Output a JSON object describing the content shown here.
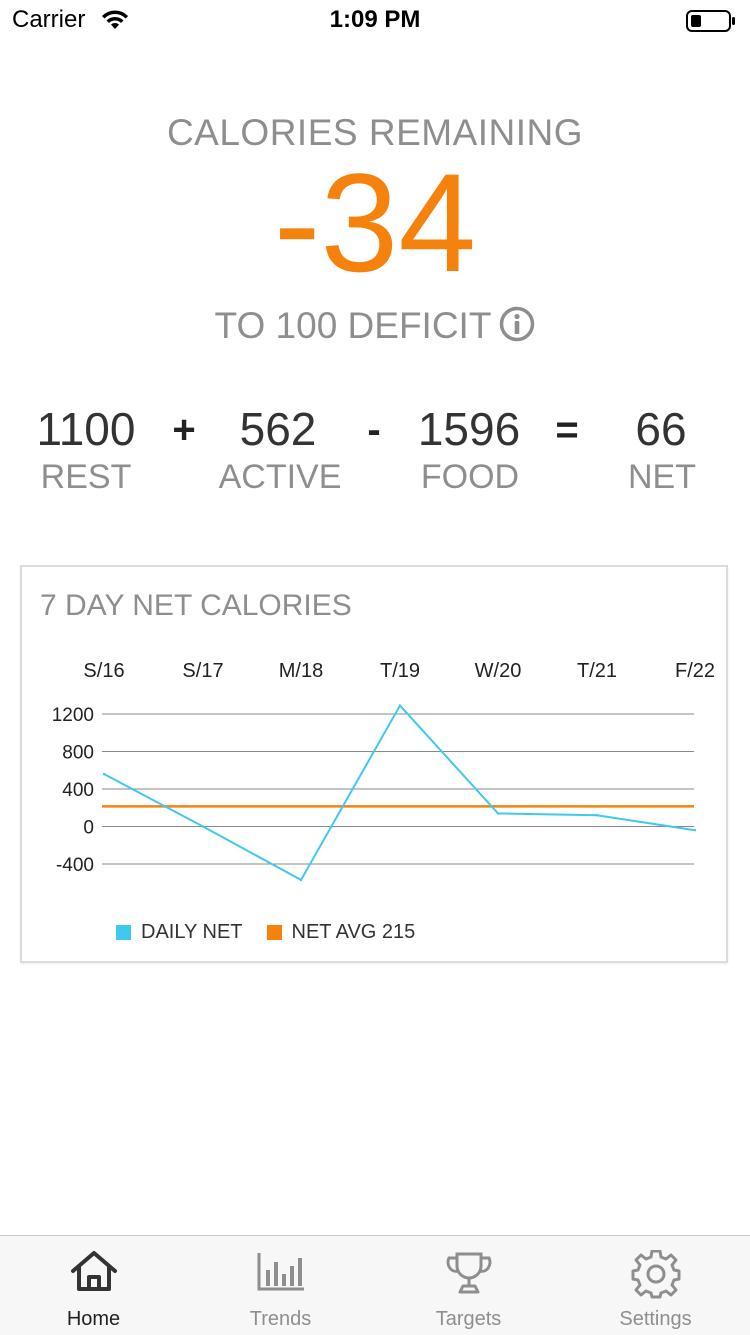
{
  "status_bar": {
    "carrier": "Carrier",
    "time": "1:09 PM"
  },
  "summary": {
    "title": "CALORIES REMAINING",
    "value": "-34",
    "subtitle": "TO 100 DEFICIT",
    "accent_color": "#f5820d"
  },
  "equation": {
    "rest": {
      "value": "1100",
      "label": "REST"
    },
    "active": {
      "value": "562",
      "label": "ACTIVE"
    },
    "food": {
      "value": "1596",
      "label": "FOOD"
    },
    "net": {
      "value": "66",
      "label": "NET"
    },
    "op_plus": "+",
    "op_minus": "-",
    "op_equals": "="
  },
  "chart_card": {
    "title": "7 DAY NET CALORIES"
  },
  "chart_data": {
    "type": "line",
    "categories": [
      "S/16",
      "S/17",
      "M/18",
      "T/19",
      "W/20",
      "T/21",
      "F/22"
    ],
    "series": [
      {
        "name": "DAILY NET",
        "values": [
          560,
          0,
          -570,
          1290,
          140,
          120,
          -40
        ],
        "color": "#3fc8f0"
      },
      {
        "name": "NET AVG 215",
        "values": [
          215,
          215,
          215,
          215,
          215,
          215,
          215
        ],
        "color": "#f5820d"
      }
    ],
    "yticks": [
      "1200",
      "800",
      "400",
      "0",
      "-400"
    ],
    "ylim": [
      -400,
      1200
    ],
    "grid": true,
    "legend": "bottom-left"
  },
  "tabs": [
    {
      "label": "Home",
      "icon": "house-icon",
      "active": true
    },
    {
      "label": "Trends",
      "icon": "bar-chart-icon",
      "active": false
    },
    {
      "label": "Targets",
      "icon": "trophy-icon",
      "active": false
    },
    {
      "label": "Settings",
      "icon": "gear-icon",
      "active": false
    }
  ]
}
